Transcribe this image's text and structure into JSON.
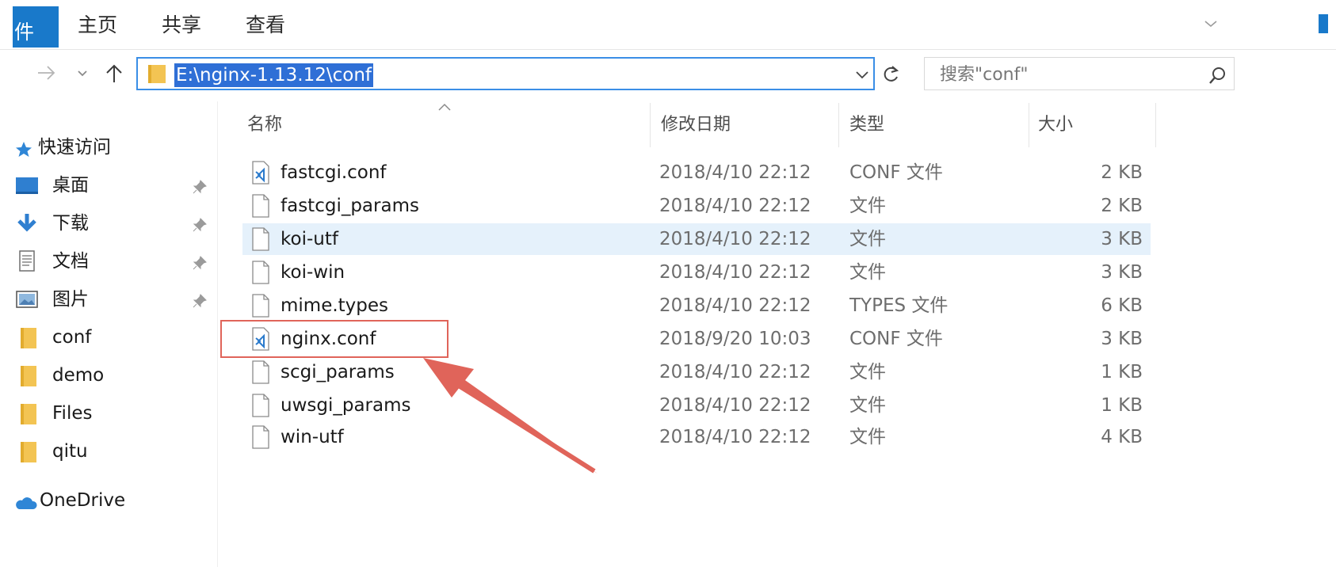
{
  "ribbon": {
    "tabs": [
      {
        "label": "件"
      },
      {
        "label": "主页"
      },
      {
        "label": "共享"
      },
      {
        "label": "查看"
      }
    ]
  },
  "nav": {
    "address": "E:\\nginx-1.13.12\\conf",
    "search_placeholder": "搜索\"conf\""
  },
  "sidebar": {
    "quick_access": "快速访问",
    "items": [
      {
        "label": "桌面",
        "icon": "desktop-icon",
        "pinned": true
      },
      {
        "label": "下载",
        "icon": "download-icon",
        "pinned": true
      },
      {
        "label": "文档",
        "icon": "document-icon",
        "pinned": true
      },
      {
        "label": "图片",
        "icon": "picture-icon",
        "pinned": true
      },
      {
        "label": "conf",
        "icon": "folder-icon",
        "pinned": false
      },
      {
        "label": "demo",
        "icon": "folder-icon",
        "pinned": false
      },
      {
        "label": "Files",
        "icon": "folder-icon",
        "pinned": false
      },
      {
        "label": "qitu",
        "icon": "folder-icon",
        "pinned": false
      }
    ],
    "onedrive": "OneDrive"
  },
  "columns": {
    "name": "名称",
    "date": "修改日期",
    "type": "类型",
    "size": "大小"
  },
  "files": [
    {
      "name": "fastcgi.conf",
      "date": "2018/4/10 22:12",
      "type": "CONF 文件",
      "size": "2 KB",
      "icon": "vscode-file-icon",
      "hover": false
    },
    {
      "name": "fastcgi_params",
      "date": "2018/4/10 22:12",
      "type": "文件",
      "size": "2 KB",
      "icon": "blank-file-icon",
      "hover": false
    },
    {
      "name": "koi-utf",
      "date": "2018/4/10 22:12",
      "type": "文件",
      "size": "3 KB",
      "icon": "blank-file-icon",
      "hover": true
    },
    {
      "name": "koi-win",
      "date": "2018/4/10 22:12",
      "type": "文件",
      "size": "3 KB",
      "icon": "blank-file-icon",
      "hover": false
    },
    {
      "name": "mime.types",
      "date": "2018/4/10 22:12",
      "type": "TYPES 文件",
      "size": "6 KB",
      "icon": "blank-file-icon",
      "hover": false
    },
    {
      "name": "nginx.conf",
      "date": "2018/9/20 10:03",
      "type": "CONF 文件",
      "size": "3 KB",
      "icon": "vscode-file-icon",
      "hover": false
    },
    {
      "name": "scgi_params",
      "date": "2018/4/10 22:12",
      "type": "文件",
      "size": "1 KB",
      "icon": "blank-file-icon",
      "hover": false
    },
    {
      "name": "uwsgi_params",
      "date": "2018/4/10 22:12",
      "type": "文件",
      "size": "1 KB",
      "icon": "blank-file-icon",
      "hover": false
    },
    {
      "name": "win-utf",
      "date": "2018/4/10 22:12",
      "type": "文件",
      "size": "4 KB",
      "icon": "blank-file-icon",
      "hover": false
    }
  ],
  "colors": {
    "accent": "#1979ca",
    "selection": "#2f6fd6",
    "hover_row": "#e5f1fb",
    "annotation": "#e0645a",
    "folder": "#f3c453"
  }
}
